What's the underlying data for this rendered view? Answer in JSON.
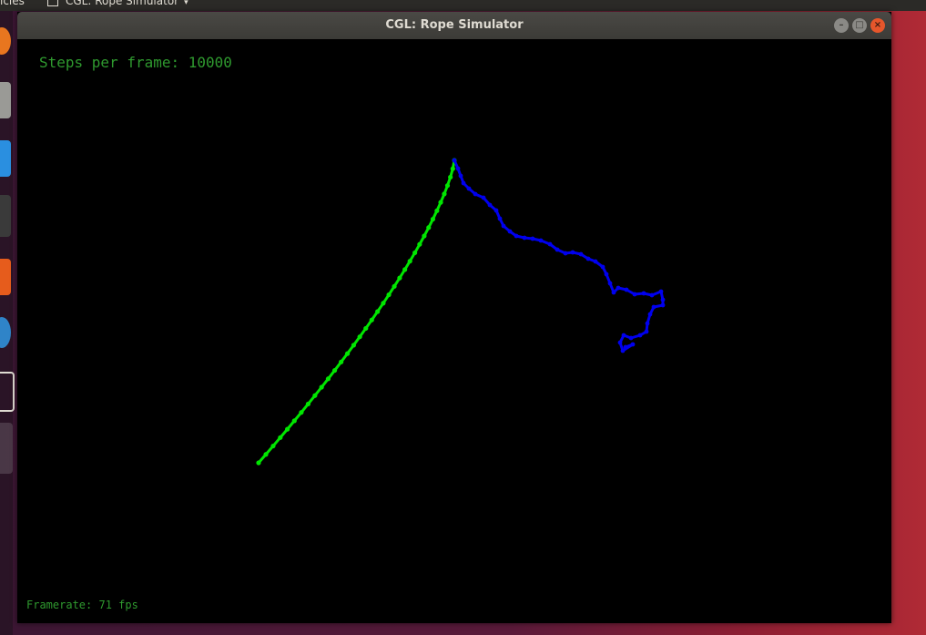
{
  "top_panel": {
    "left_label": "icles",
    "app_menu_label": "CGL: Rope Simulator",
    "caret": "▾"
  },
  "window": {
    "title": "CGL: Rope Simulator",
    "controls": {
      "minimize": "–",
      "maximize": "□",
      "close": "×"
    }
  },
  "hud": {
    "steps_label": "Steps per frame: 10000",
    "framerate_label": "Framerate: 71 fps"
  },
  "colors": {
    "rope_green": "#00e600",
    "rope_blue": "#0000ee",
    "hud_text": "#2f9a2f",
    "background": "#000000"
  },
  "launcher_icons": [
    "firefox-icon",
    "files-icon",
    "software-icon",
    "terminal-icon",
    "store-icon",
    "browser-icon",
    "window-icon",
    "window-icon"
  ]
}
